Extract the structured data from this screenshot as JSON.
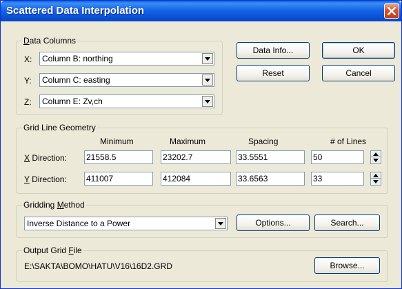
{
  "window": {
    "title": "Scattered Data Interpolation"
  },
  "data_columns": {
    "legend": "Data Columns",
    "x": {
      "label": "X:",
      "value": "Column B:  northing"
    },
    "y": {
      "label": "Y:",
      "value": "Column C:  easting"
    },
    "z": {
      "label": "Z:",
      "value": "Column E:  Zv,ch"
    }
  },
  "buttons": {
    "data_info": "Data Info...",
    "ok": "OK",
    "reset": "Reset",
    "cancel": "Cancel",
    "options": "Options...",
    "search": "Search...",
    "browse": "Browse..."
  },
  "grid_geometry": {
    "legend": "Grid Line Geometry",
    "headers": {
      "minimum": "Minimum",
      "maximum": "Maximum",
      "spacing": "Spacing",
      "lines": "# of Lines"
    },
    "x_direction": {
      "label": "X Direction:",
      "minimum": "21558.5",
      "maximum": "23202.7",
      "spacing": "33.5551",
      "lines": "50"
    },
    "y_direction": {
      "label": "Y Direction:",
      "minimum": "411007",
      "maximum": "412084",
      "spacing": "33.6563",
      "lines": "33"
    }
  },
  "gridding_method": {
    "legend": "Gridding Method",
    "value": "Inverse Distance to a Power"
  },
  "output_grid_file": {
    "legend": "Output Grid File",
    "path": "E:\\SAKTA\\BOMO\\HATU\\V16\\16D2.GRD"
  },
  "colors": {
    "title_bar": "#0a51d6",
    "dialog_bg": "#ece9d8",
    "close_button": "#d9532a"
  }
}
